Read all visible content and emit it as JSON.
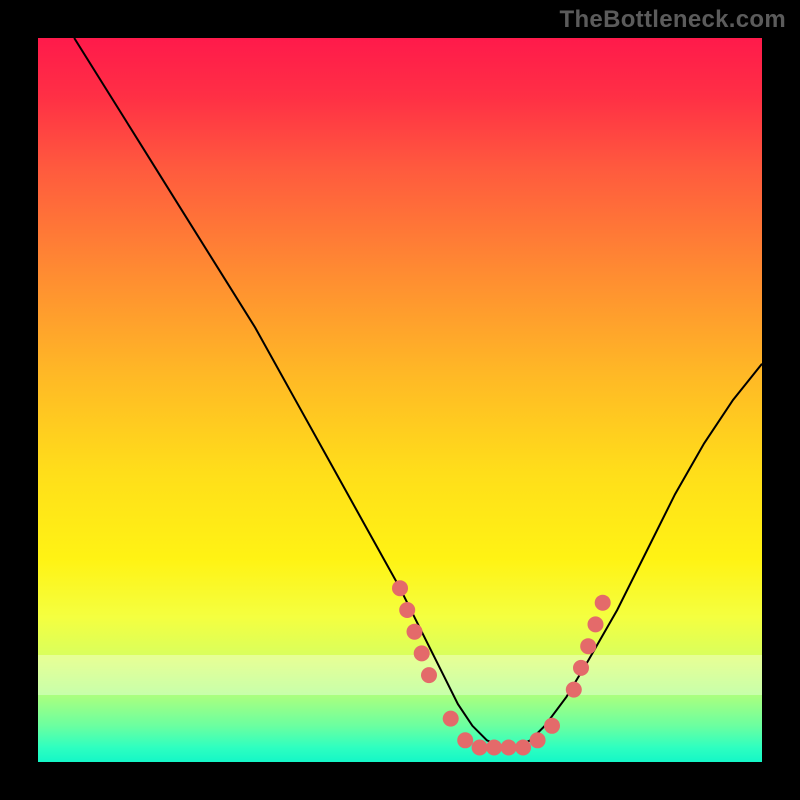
{
  "watermark": "TheBottleneck.com",
  "colors": {
    "background": "#000000",
    "marker": "#e46a6a",
    "curve": "#000000"
  },
  "chart_data": {
    "type": "line",
    "title": "",
    "xlabel": "",
    "ylabel": "",
    "xlim": [
      0,
      100
    ],
    "ylim": [
      0,
      100
    ],
    "grid": false,
    "legend": false,
    "series": [
      {
        "name": "bottleneck-curve",
        "x": [
          5,
          10,
          15,
          20,
          25,
          30,
          35,
          40,
          45,
          50,
          53,
          56,
          58,
          60,
          62,
          64,
          66,
          68,
          70,
          73,
          76,
          80,
          84,
          88,
          92,
          96,
          100
        ],
        "y": [
          100,
          92,
          84,
          76,
          68,
          60,
          51,
          42,
          33,
          24,
          18,
          12,
          8,
          5,
          3,
          2,
          2,
          3,
          5,
          9,
          14,
          21,
          29,
          37,
          44,
          50,
          55
        ]
      }
    ],
    "markers": [
      {
        "x": 50,
        "y": 24
      },
      {
        "x": 51,
        "y": 21
      },
      {
        "x": 52,
        "y": 18
      },
      {
        "x": 53,
        "y": 15
      },
      {
        "x": 54,
        "y": 12
      },
      {
        "x": 57,
        "y": 6
      },
      {
        "x": 59,
        "y": 3
      },
      {
        "x": 61,
        "y": 2
      },
      {
        "x": 63,
        "y": 2
      },
      {
        "x": 65,
        "y": 2
      },
      {
        "x": 67,
        "y": 2
      },
      {
        "x": 69,
        "y": 3
      },
      {
        "x": 71,
        "y": 5
      },
      {
        "x": 74,
        "y": 10
      },
      {
        "x": 75,
        "y": 13
      },
      {
        "x": 76,
        "y": 16
      },
      {
        "x": 77,
        "y": 19
      },
      {
        "x": 78,
        "y": 22
      }
    ],
    "pale_band_y": 12
  }
}
